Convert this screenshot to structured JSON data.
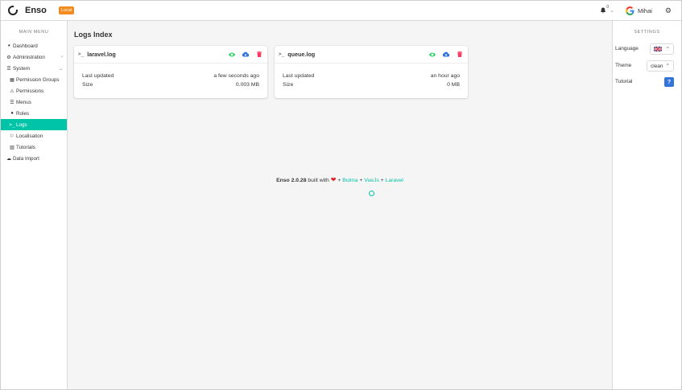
{
  "navbar": {
    "brand": "Enso",
    "env_badge": "Local",
    "notifications_count": "0",
    "user_name": "Mihai"
  },
  "sidebar": {
    "title": "MAIN MENU",
    "items": [
      {
        "label": "Dashboard",
        "icon": "dashboard-icon"
      },
      {
        "label": "Administration",
        "icon": "users-cog-icon"
      },
      {
        "label": "System",
        "icon": "list-icon"
      },
      {
        "label": "Permission Groups",
        "icon": "sitemap-icon"
      },
      {
        "label": "Permissions",
        "icon": "warning-icon"
      },
      {
        "label": "Menus",
        "icon": "list-icon"
      },
      {
        "label": "Roles",
        "icon": "circle-icon"
      },
      {
        "label": "Logs",
        "icon": "terminal-icon"
      },
      {
        "label": "Localisation",
        "icon": "language-icon"
      },
      {
        "label": "Tutorials",
        "icon": "book-icon"
      },
      {
        "label": "Data Import",
        "icon": "cloud-upload-icon"
      }
    ]
  },
  "main": {
    "title": "Logs Index",
    "logs": [
      {
        "name": "laravel.log",
        "updated_label": "Last updated",
        "updated_value": "a few seconds ago",
        "size_label": "Size",
        "size_value": "0.003 MB"
      },
      {
        "name": "queue.log",
        "updated_label": "Last updated",
        "updated_value": "an hour ago",
        "size_label": "Size",
        "size_value": "0 MB"
      }
    ],
    "footer": {
      "version": "Enso 2.0.28",
      "built_with": "built with",
      "plus1": "+",
      "bulma": "Bulma",
      "plus2": "+",
      "vuejs": "VueJs",
      "plus3": "+",
      "laravel": "Laravel"
    }
  },
  "settings": {
    "title": "SETTINGS",
    "language_label": "Language",
    "theme_label": "Theme",
    "theme_value": "clean",
    "tutorial_label": "Tutorial",
    "tutorial_button": "?"
  },
  "colors": {
    "accent": "#00c4a7",
    "badge": "#f48b1f",
    "view": "#23d160",
    "download": "#3273dc",
    "delete": "#ff3860"
  }
}
